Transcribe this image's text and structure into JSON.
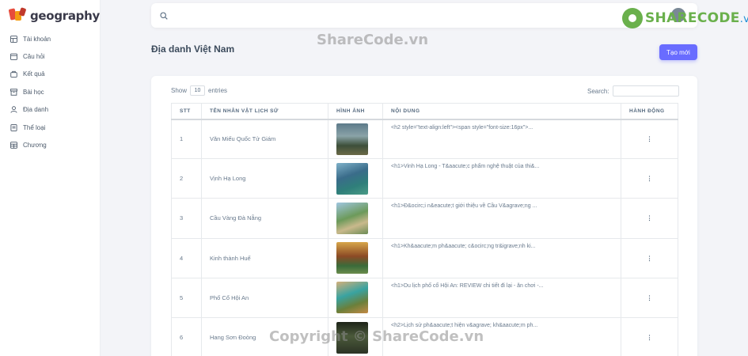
{
  "app": {
    "logo_text": "geography"
  },
  "sidebar": {
    "items": [
      {
        "label": "Tài khoản",
        "icon": "grid-icon"
      },
      {
        "label": "Câu hỏi",
        "icon": "calendar-icon"
      },
      {
        "label": "Kết quả",
        "icon": "bag-icon"
      },
      {
        "label": "Bài học",
        "icon": "archive-icon"
      },
      {
        "label": "Địa danh",
        "icon": "user-icon"
      },
      {
        "label": "Thể loại",
        "icon": "document-icon"
      },
      {
        "label": "Chương",
        "icon": "table-icon"
      }
    ]
  },
  "topbar": {
    "search_placeholder": ""
  },
  "brand": {
    "name": "SHARECODE",
    "suffix": ".vn"
  },
  "watermark": {
    "top": "ShareCode.vn",
    "bottom": "Copyright © ShareCode.vn"
  },
  "page": {
    "title": "Địa danh Việt Nam",
    "create_button": "Tạo mới"
  },
  "table_controls": {
    "show_label": "Show",
    "page_size": "10",
    "entries_label": "entries",
    "search_label": "Search:"
  },
  "table": {
    "columns": [
      "STT",
      "TÊN NHÂN VẬT LỊCH SỬ",
      "HÌNH ẢNH",
      "NỘI DUNG",
      "HÀNH ĐỘNG"
    ],
    "rows": [
      {
        "stt": "1",
        "name": "Văn Miếu Quốc Tử Giám",
        "content": "<h2 style=\"text-align:left\"><span style=\"font-size:16px\">...",
        "action": "⋮"
      },
      {
        "stt": "2",
        "name": "Vịnh Hạ Long",
        "content": "<h1>Vinh Hạ Long - T&aacute;c phẩm nghệ thuật của thi&...",
        "action": "⋮"
      },
      {
        "stt": "3",
        "name": "Cầu Vàng Đà Nẵng",
        "content": "<h1>Đ&ocirc;i n&eacute;t giới thiệu về Cầu V&agrave;ng ...",
        "action": "⋮"
      },
      {
        "stt": "4",
        "name": "Kinh thành Huế",
        "content": "<h1>Kh&aacute;m ph&aacute; c&ocirc;ng tr&igrave;nh ki...",
        "action": "⋮"
      },
      {
        "stt": "5",
        "name": "Phố Cổ Hội An",
        "content": "<h1>Du lịch phố cổ Hội An: REVIEW chi tiết đi lại - ăn chơi -...",
        "action": "⋮"
      },
      {
        "stt": "6",
        "name": "Hang Sơn Đoòng",
        "content": "<h2>Lịch sử ph&aacute;t hiện v&agrave; kh&aacute;m ph...",
        "action": "⋮"
      }
    ]
  }
}
